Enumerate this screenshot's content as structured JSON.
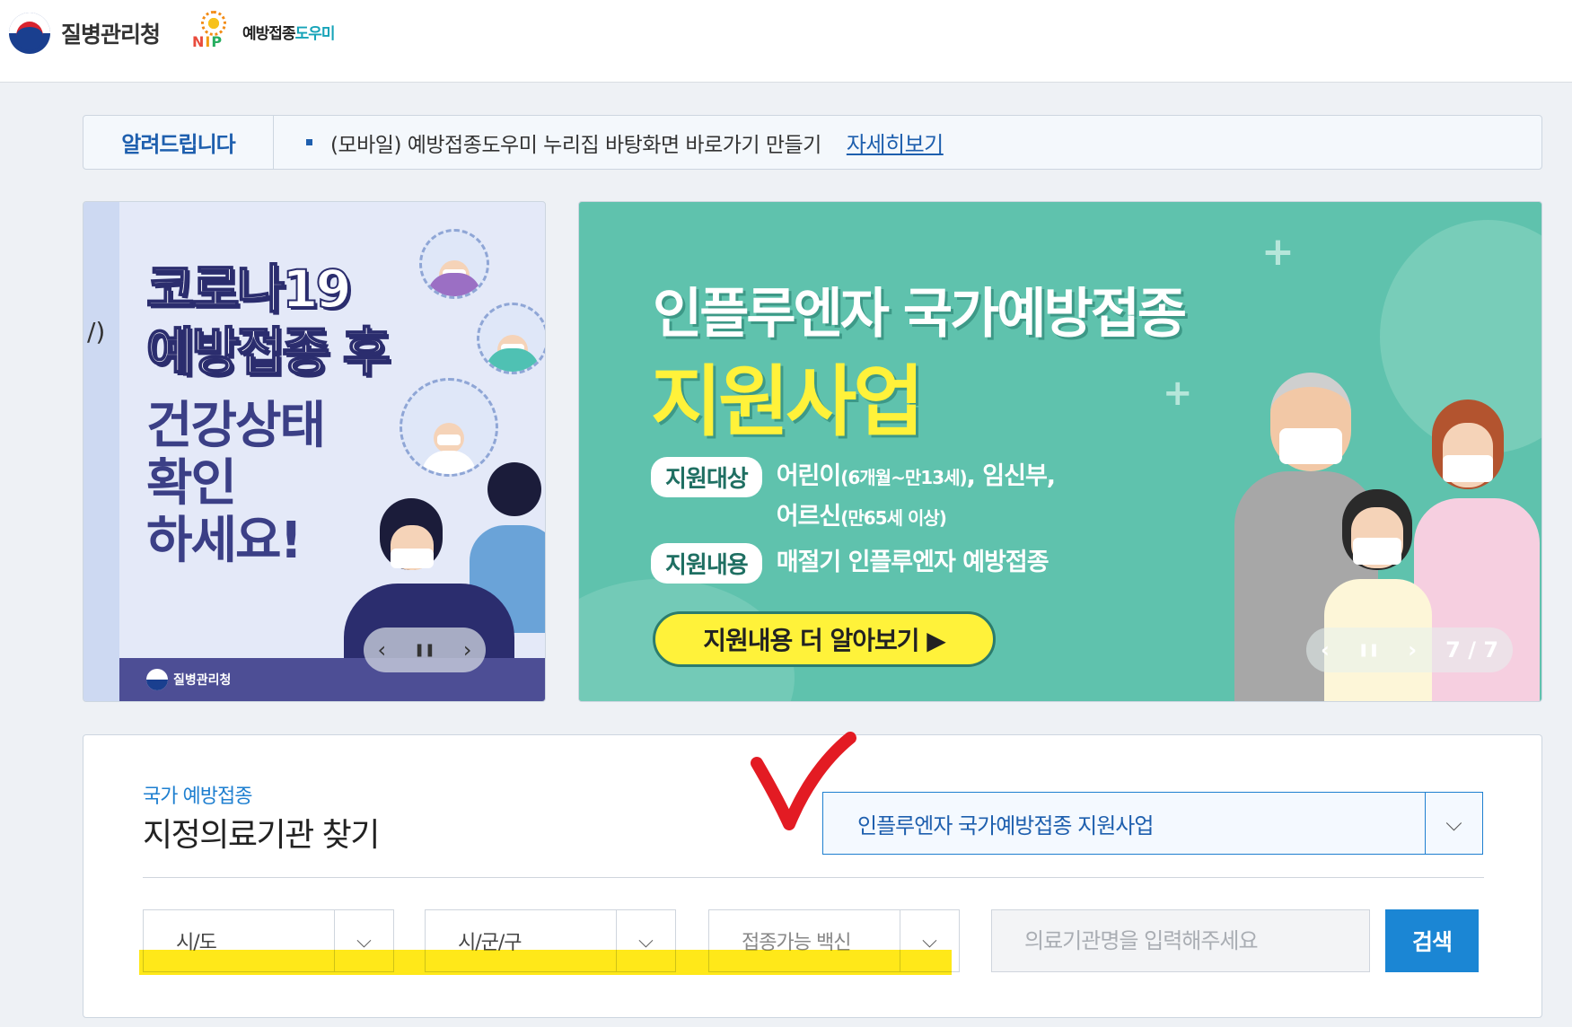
{
  "header": {
    "org_name": "질병관리청",
    "nip_letters": [
      "N",
      "I",
      "P"
    ],
    "service_name_main": "예방접종",
    "service_name_accent": "도우미"
  },
  "notice": {
    "label": "알려드립니다",
    "text": "(모바일) 예방접종도우미 누리집 바탕화면 바로가기 만들기",
    "link": "자세히보기"
  },
  "banner_left": {
    "edge_mark": "/)",
    "title_lines": [
      "코로나19",
      "예방접종 후"
    ],
    "sub_lines": [
      "건강상태",
      "확인",
      "하세요!"
    ],
    "footer_org": "질병관리청",
    "controls": {
      "prev": "‹",
      "pause": "❚❚",
      "next": "›"
    }
  },
  "banner_right": {
    "title": "인플루엔자 국가예방접종",
    "title_highlight": "지원사업",
    "target_label": "지원대상",
    "target_line1_main": "어린이",
    "target_line1_small": "(6개월~만13세)",
    "target_line1_rest": ", 임신부,",
    "target_line2_main": "어르신",
    "target_line2_small": "(만65세 이상)",
    "content_label": "지원내용",
    "content_text": "매절기 인플루엔자 예방접종",
    "cta": "지원내용 더 알아보기 ▶",
    "controls": {
      "prev": "‹",
      "pause": "❚❚",
      "next": "›",
      "page": "7 / 7"
    }
  },
  "search": {
    "kicker": "국가 예방접종",
    "title": "지정의료기관 찾기",
    "program_value": "인플루엔자 국가예방접종 지원사업",
    "program_arrow_icon": "chevron-down-icon",
    "sido_value": "시/도",
    "sigungu_value": "시/군/구",
    "vaccine_value": "접종가능 백신",
    "institution_placeholder": "의료기관명을 입력해주세요",
    "search_button": "검색"
  },
  "colors": {
    "accent_blue": "#1e7fd0",
    "button_blue": "#1b86d4",
    "banner_teal": "#5fc2ad",
    "annotation_yellow": "#ffe600",
    "annotation_red": "#e31b23"
  }
}
